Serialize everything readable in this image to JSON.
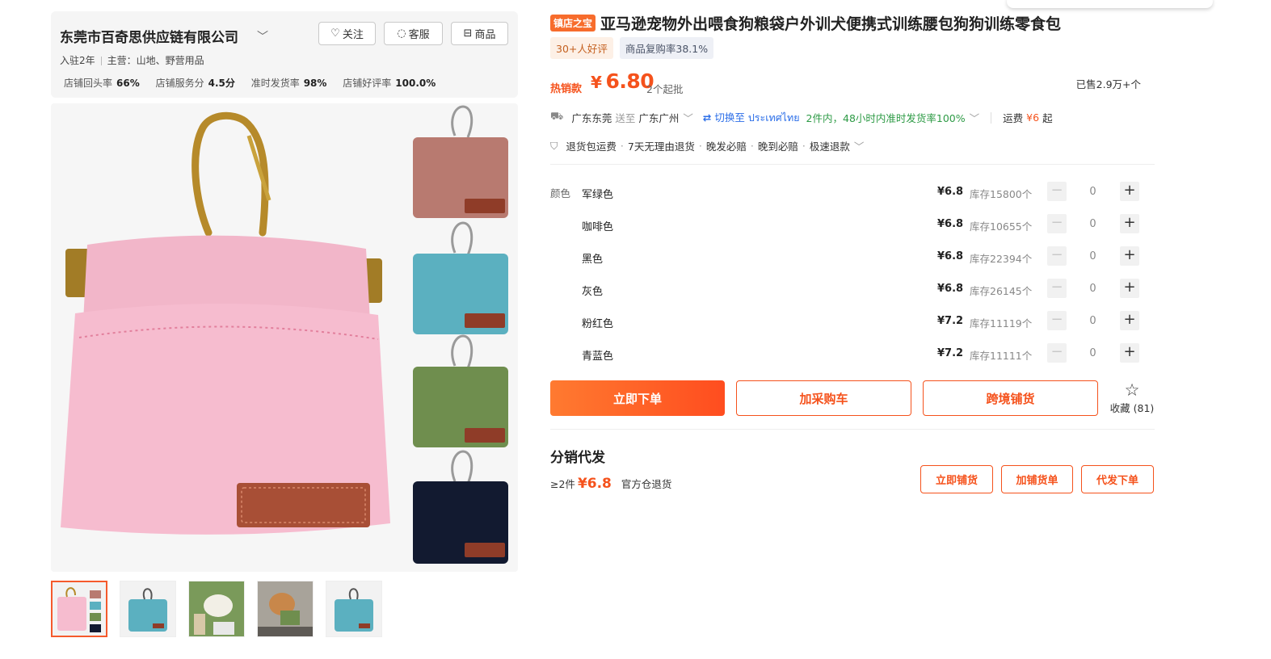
{
  "store": {
    "name": "东莞市百奇思供应链有限公司",
    "follow_label": "关注",
    "service_label": "客服",
    "products_label": "商品",
    "years": "入驻2年",
    "main_business": "主营：山地、野营用品",
    "stats": [
      {
        "label": "店铺回头率",
        "value": "66%"
      },
      {
        "label": "店铺服务分",
        "value": "4.5分"
      },
      {
        "label": "准时发货率",
        "value": "98%"
      },
      {
        "label": "店铺好评率",
        "value": "100.0%"
      }
    ]
  },
  "product": {
    "badge": "镇店之宝",
    "title": "亚马逊宠物外出喂食狗粮袋户外训犬便携式训练腰包狗狗训练零食包",
    "tag_reviews": "30+人好评",
    "tag_repurchase": "商品复购率38.1%",
    "hot_label": "热销款",
    "price_currency": "¥",
    "price": "6.80",
    "moq": "2个起批",
    "sold": "已售2.9万+个"
  },
  "shipping": {
    "from": "广东东莞",
    "to_word": "送至",
    "to": "广东广州",
    "switch_label": "切换至",
    "switch_target": "ประเทศไทย",
    "delivery": "2件内，48小时内准时发货率100%",
    "freight_label": "运费",
    "freight_price": "¥6",
    "freight_suffix": "起"
  },
  "services": [
    "退货包运费",
    "7天无理由退货",
    "晚发必赔",
    "晚到必赔",
    "极速退款"
  ],
  "sku": {
    "label": "颜色",
    "rows": [
      {
        "name": "军绿色",
        "price": "¥6.8",
        "stock": "库存15800个",
        "qty": "0"
      },
      {
        "name": "咖啡色",
        "price": "¥6.8",
        "stock": "库存10655个",
        "qty": "0"
      },
      {
        "name": "黑色",
        "price": "¥6.8",
        "stock": "库存22394个",
        "qty": "0"
      },
      {
        "name": "灰色",
        "price": "¥6.8",
        "stock": "库存26145个",
        "qty": "0"
      },
      {
        "name": "粉红色",
        "price": "¥7.2",
        "stock": "库存11119个",
        "qty": "0"
      },
      {
        "name": "青蓝色",
        "price": "¥7.2",
        "stock": "库存11111个",
        "qty": "0"
      }
    ]
  },
  "actions": {
    "buy_now": "立即下单",
    "add_cart": "加采购车",
    "cross_border": "跨境铺货",
    "favorite": "收藏 (81)"
  },
  "distribution": {
    "title": "分销代发",
    "min": "≥2件",
    "price": "¥6.8",
    "return_note": "官方仓退货",
    "btn_list": "立即铺货",
    "btn_add": "加铺货单",
    "btn_order": "代发下单"
  },
  "icons": [
    "heart-plus-icon",
    "chat-icon",
    "store-icon",
    "chevron-down-icon",
    "truck-icon",
    "switch-arrows-icon",
    "shield-check-icon",
    "minus-icon",
    "plus-icon",
    "star-icon"
  ],
  "colors": {
    "accent": "#f5521c",
    "link_blue": "#2b6ee8",
    "success_green": "#2e9b46",
    "product_pink": "#f4b8cb",
    "variant_brown": "#b87a70",
    "variant_teal": "#5bb0c0",
    "variant_green": "#6f8e4e",
    "variant_navy": "#121a30"
  }
}
